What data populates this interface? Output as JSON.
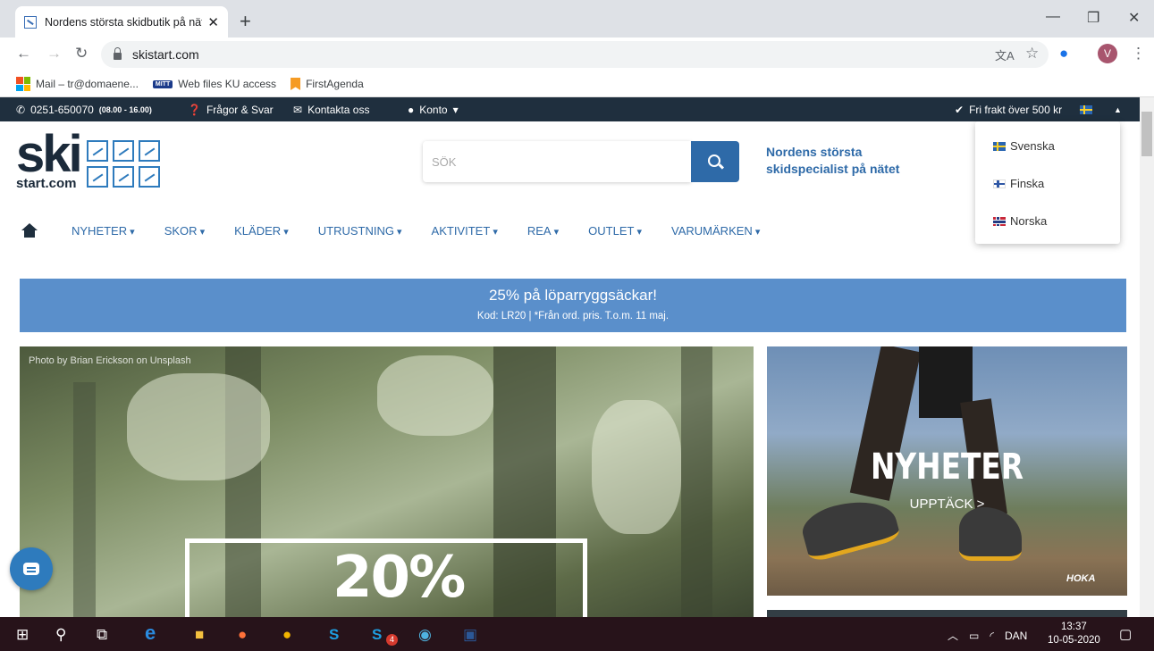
{
  "browser": {
    "tab_title": "Nordens största skidbutik på nät",
    "tab_close": "✕",
    "new_tab": "+",
    "url": "skistart.com",
    "window_controls": {
      "minimize": "—",
      "restore": "❐",
      "close": "✕"
    },
    "profile_initial": "V",
    "bookmarks": [
      "Mail – tr@domaene...",
      "Web files KU access",
      "FirstAgenda"
    ],
    "bookmark_mitt_tag": "MITT"
  },
  "topbar": {
    "phone": "0251-650070",
    "phone_hours": "(08.00 - 16.00)",
    "faq": "Frågor & Svar",
    "contact": "Kontakta oss",
    "account": "Konto",
    "shipping": "Fri frakt över 500 kr"
  },
  "logo": {
    "main": "ski",
    "sub": "start.com"
  },
  "search": {
    "placeholder": "SÖK"
  },
  "slogan": "Nordens största skidspecialist på nätet",
  "nav": [
    "NYHETER",
    "SKOR",
    "KLÄDER",
    "UTRUSTNING",
    "AKTIVITET",
    "REA",
    "OUTLET",
    "VARUMÄRKEN"
  ],
  "language_menu": [
    "Svenska",
    "Finska",
    "Norska"
  ],
  "promo": {
    "headline": "25% på löparryggsäckar!",
    "subline": "Kod: LR20 | *Från ord. pris. T.o.m. 11 maj."
  },
  "hero": {
    "credit": "Photo by Brian Erickson on Unsplash",
    "headline": "20%"
  },
  "side_promo": {
    "headline": "NYHETER",
    "link": "UPPTÄCK >",
    "brand": "HOKA"
  },
  "taskbar": {
    "language": "DAN",
    "time": "13:37",
    "date": "10-05-2020",
    "skype_badge": "4"
  },
  "colors": {
    "topbar": "#1f2f3e",
    "accent": "#2e6aa8",
    "promo": "#5a8fcb",
    "taskbar": "#27131a"
  }
}
